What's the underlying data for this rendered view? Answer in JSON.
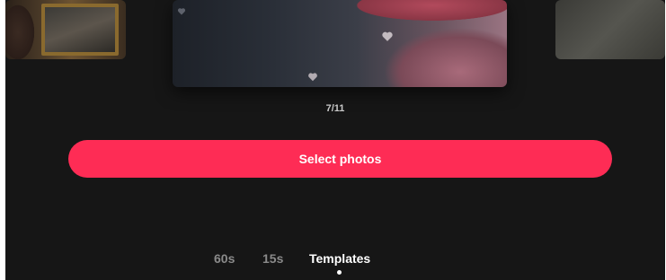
{
  "carousel": {
    "counter": "7/11"
  },
  "actions": {
    "select_photos_label": "Select photos"
  },
  "mode_tabs": [
    {
      "label": "60s",
      "active": false
    },
    {
      "label": "15s",
      "active": false
    },
    {
      "label": "Templates",
      "active": true
    }
  ],
  "colors": {
    "background": "#161616",
    "accent": "#fe2c55",
    "tab_active": "#ffffff",
    "tab_inactive": "#8a8a8a"
  }
}
